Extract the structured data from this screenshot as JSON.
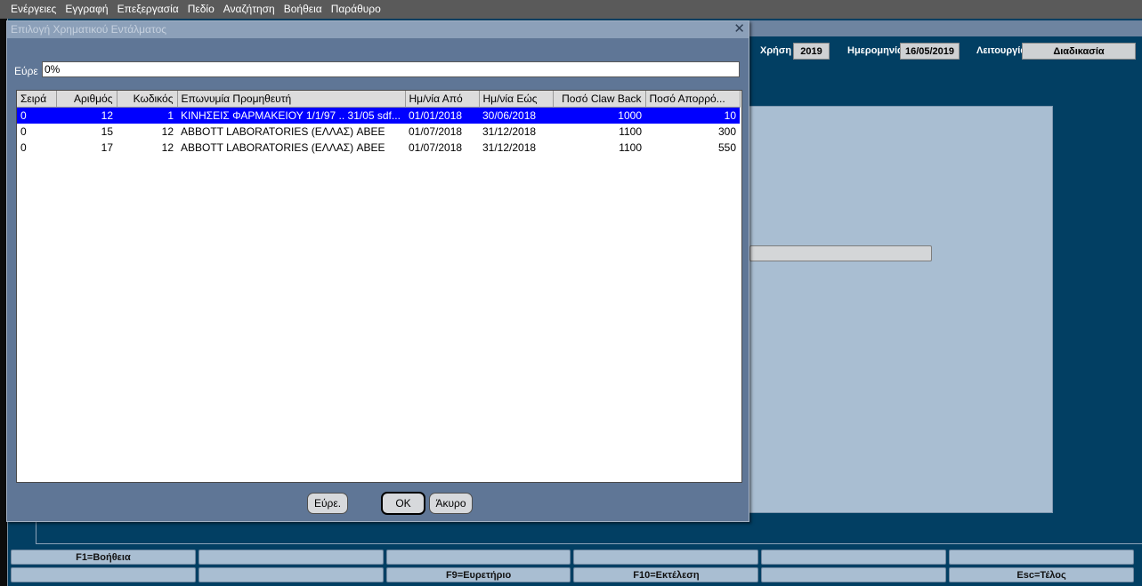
{
  "menu": [
    {
      "label": "Ενέργειες"
    },
    {
      "label": "Εγγραφή"
    },
    {
      "label": "Επεξεργασία"
    },
    {
      "label": "Πεδίο"
    },
    {
      "label": "Αναζήτηση"
    },
    {
      "label": "Βοήθεια"
    },
    {
      "label": "Παράθυρο"
    }
  ],
  "header": {
    "year_label": "Χρήση",
    "year_value": "2019",
    "date_label": "Ημερομηνία",
    "date_value": "16/05/2019",
    "function_label": "Λειτουργία",
    "function_value": "Διαδικασία"
  },
  "dialog": {
    "title": "Επιλογή Χρηματικού Εντάλματος",
    "close_glyph": "✕",
    "find_label": "Εύρε",
    "find_value": "0%",
    "columns": [
      "Σειρά",
      "Αριθμός",
      "Κωδικός",
      "Επωνυμία Προμηθευτή",
      "Ημ/νία Από",
      "Ημ/νία Εώς",
      "Ποσό Claw Back",
      "Ποσό Απορρό..."
    ],
    "rows": [
      {
        "seira": "0",
        "arithmos": "12",
        "kodikos": "1",
        "eponymia": "ΚΙΝΗΣΕΙΣ ΦΑΡΜΑΚΕΙΟΥ 1/1/97 .. 31/05 sdf...",
        "apo": "01/01/2018",
        "eos": "30/06/2018",
        "clawback": "1000",
        "aporr": "10"
      },
      {
        "seira": "0",
        "arithmos": "15",
        "kodikos": "12",
        "eponymia": "ABBOTT LABORATORIES (ΕΛΛΑΣ) ΑΒΕΕ",
        "apo": "01/07/2018",
        "eos": "31/12/2018",
        "clawback": "1100",
        "aporr": "300"
      },
      {
        "seira": "0",
        "arithmos": "17",
        "kodikos": "12",
        "eponymia": "ABBOTT LABORATORIES (ΕΛΛΑΣ) ΑΒΕΕ",
        "apo": "01/07/2018",
        "eos": "31/12/2018",
        "clawback": "1100",
        "aporr": "550"
      }
    ],
    "selected_row": 0,
    "buttons": {
      "find": "Εύρε.",
      "ok": "OK",
      "cancel": "Άκυρο"
    }
  },
  "fkeys": {
    "row1": [
      "F1=Βοήθεια",
      "",
      "",
      "",
      "",
      ""
    ],
    "row2": [
      "",
      "",
      "F9=Ευρετήριο",
      "F10=Εκτέλεση",
      "",
      "Esc=Τέλος"
    ]
  },
  "colors": {
    "menubar": "#5a5a5a",
    "form_bg": "#023f63",
    "dialog_bg": "#5f7696",
    "selection": "#0000ff",
    "canvas": "#a9bed2"
  }
}
